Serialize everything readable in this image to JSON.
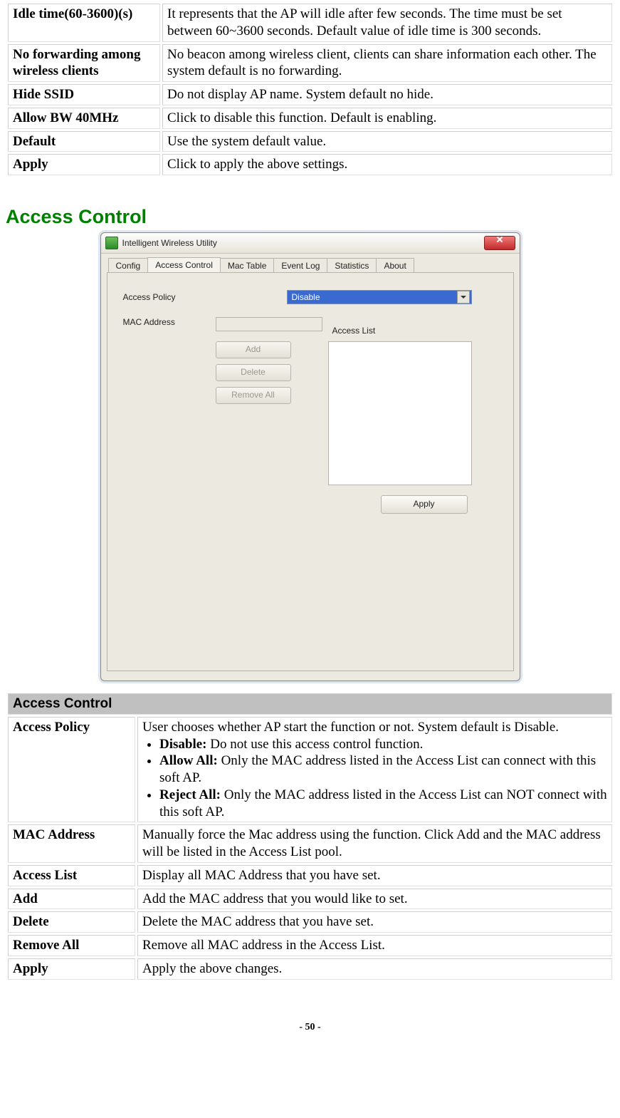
{
  "tables": {
    "top": {
      "rows": [
        {
          "key": "Idle time(60-3600)(s)",
          "val": "It represents that the AP will idle after few seconds. The time must be set between 60~3600 seconds. Default value of idle time is 300 seconds."
        },
        {
          "key": "No forwarding among wireless clients",
          "val": "No beacon among wireless client, clients can share information each other. The system default is no forwarding."
        },
        {
          "key": "Hide SSID",
          "val": "Do not display AP name. System default no hide."
        },
        {
          "key": "Allow BW 40MHz",
          "val": "Click to disable this function. Default is enabling."
        },
        {
          "key": "Default",
          "val": "Use the system default value."
        },
        {
          "key": "Apply",
          "val": "Click to apply the above settings."
        }
      ]
    },
    "access": {
      "header": "Access Control",
      "policy_key": "Access Policy",
      "policy_intro": "User chooses whether AP start the function or not. System default is Disable.",
      "policy_bullets": [
        {
          "b": "Disable:",
          "t": " Do not use this access control function."
        },
        {
          "b": "Allow All:",
          "t": " Only the MAC address listed in the Access List can connect with this soft AP."
        },
        {
          "b": "Reject All:",
          "t": " Only the MAC address listed in the Access List can NOT connect with this soft AP."
        }
      ],
      "rows": [
        {
          "key": "MAC Address",
          "val": "Manually force the Mac address using the function. Click Add and the MAC address will be listed in the Access List pool."
        },
        {
          "key": "Access List",
          "val": "Display all MAC Address that you have set."
        },
        {
          "key": "Add",
          "val": "Add the MAC address that you would like to set."
        },
        {
          "key": "Delete",
          "val": "Delete the MAC address that you have set."
        },
        {
          "key": "Remove All",
          "val": "Remove all MAC address in the Access List."
        },
        {
          "key": "Apply",
          "val": "Apply the above changes."
        }
      ]
    }
  },
  "heading": "Access Control",
  "window": {
    "title": "Intelligent Wireless Utility",
    "tabs": [
      "Config",
      "Access Control",
      "Mac Table",
      "Event Log",
      "Statistics",
      "About"
    ],
    "active_tab_index": 1,
    "labels": {
      "access_policy": "Access Policy",
      "mac_address": "MAC Address",
      "access_list": "Access List"
    },
    "combo_value": "Disable",
    "buttons": {
      "add": "Add",
      "delete": "Delete",
      "remove_all": "Remove All",
      "apply": "Apply"
    }
  },
  "page_number": "- 50 -"
}
